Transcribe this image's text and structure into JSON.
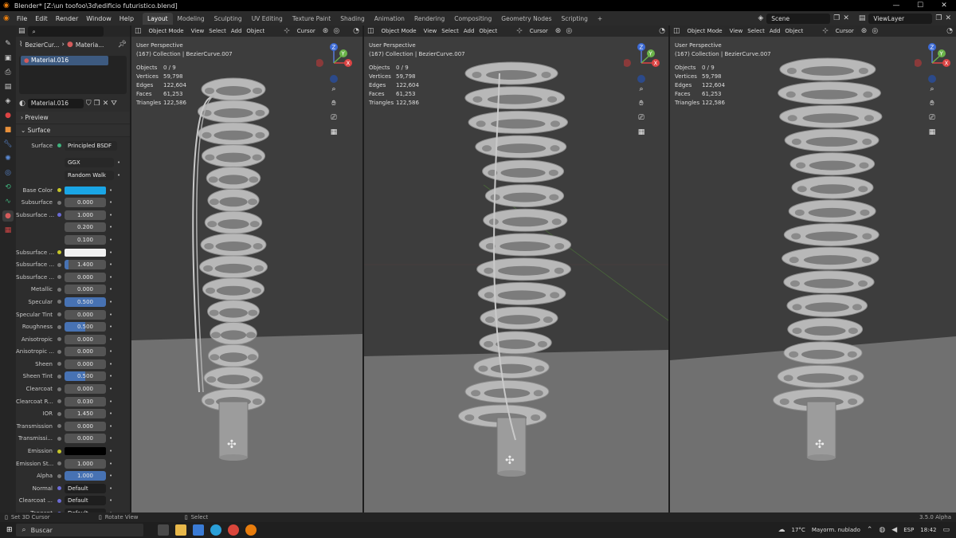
{
  "window": {
    "title": "Blender* [Z:\\un toofoo\\3d\\edificio futuristico.blend]",
    "controls": [
      "—",
      "☐",
      "✕"
    ]
  },
  "menu": {
    "items": [
      "File",
      "Edit",
      "Render",
      "Window",
      "Help"
    ]
  },
  "workspaces": [
    "Layout",
    "Modeling",
    "Sculpting",
    "UV Editing",
    "Texture Paint",
    "Shading",
    "Animation",
    "Rendering",
    "Compositing",
    "Geometry Nodes",
    "Scripting",
    "+"
  ],
  "scene": {
    "label": "Scene"
  },
  "viewlayer": {
    "label": "ViewLayer"
  },
  "properties": {
    "breadcrumb": [
      "BezierCur...",
      "Materia..."
    ],
    "slot": "Material.016",
    "material": "Material.016",
    "panels": {
      "preview": "Preview",
      "surface": "Surface"
    },
    "surface_shader": {
      "label": "Surface",
      "value": "Principled BSDF"
    },
    "distribution": "GGX",
    "subsurface_method": "Random Walk",
    "rows": [
      {
        "label": "Base Color",
        "type": "color",
        "color": "#1aa6e6"
      },
      {
        "label": "Subsurface",
        "type": "num",
        "value": "0.000"
      },
      {
        "label": "Subsurface ...",
        "type": "num",
        "value": "1.000",
        "dot": "blue"
      },
      {
        "label": "",
        "type": "num",
        "value": "0.200",
        "nodot": true
      },
      {
        "label": "",
        "type": "num",
        "value": "0.100",
        "nodot": true
      },
      {
        "label": "Subsurface ...",
        "type": "color",
        "color": "#f0f0f0"
      },
      {
        "label": "Subsurface ...",
        "type": "num",
        "value": "1.400",
        "fill": "part"
      },
      {
        "label": "Subsurface ...",
        "type": "num",
        "value": "0.000"
      },
      {
        "label": "Metallic",
        "type": "num",
        "value": "0.000"
      },
      {
        "label": "Specular",
        "type": "num",
        "value": "0.500",
        "fill": "full"
      },
      {
        "label": "Specular Tint",
        "type": "num",
        "value": "0.000"
      },
      {
        "label": "Roughness",
        "type": "num",
        "value": "0.500",
        "fill": "half"
      },
      {
        "label": "Anisotropic",
        "type": "num",
        "value": "0.000"
      },
      {
        "label": "Anisotropic ...",
        "type": "num",
        "value": "0.000"
      },
      {
        "label": "Sheen",
        "type": "num",
        "value": "0.000"
      },
      {
        "label": "Sheen Tint",
        "type": "num",
        "value": "0.500",
        "fill": "half"
      },
      {
        "label": "Clearcoat",
        "type": "num",
        "value": "0.000"
      },
      {
        "label": "Clearcoat R...",
        "type": "num",
        "value": "0.030"
      },
      {
        "label": "IOR",
        "type": "num",
        "value": "1.450"
      },
      {
        "label": "Transmission",
        "type": "num",
        "value": "0.000"
      },
      {
        "label": "Transmissi...",
        "type": "num",
        "value": "0.000"
      },
      {
        "label": "Emission",
        "type": "color",
        "color": "#000000"
      },
      {
        "label": "Emission St...",
        "type": "num",
        "value": "1.000"
      },
      {
        "label": "Alpha",
        "type": "num",
        "value": "1.000",
        "fill": "full"
      },
      {
        "label": "Normal",
        "type": "text",
        "value": "Default",
        "dot": "blue"
      },
      {
        "label": "Clearcoat ...",
        "type": "text",
        "value": "Default",
        "dot": "blue"
      },
      {
        "label": "Tangent",
        "type": "text",
        "value": "Default",
        "dot": "blue"
      }
    ]
  },
  "viewport": {
    "header": {
      "mode": "Object Mode",
      "menus": [
        "View",
        "Select",
        "Add",
        "Object"
      ],
      "pivot": "Cursor"
    },
    "perspective": "User Perspective",
    "collection": "(167) Collection | BezierCurve.007",
    "stats": [
      {
        "k": "Objects",
        "v": "0 / 9"
      },
      {
        "k": "Vertices",
        "v": "59,798"
      },
      {
        "k": "Edges",
        "v": "122,604"
      },
      {
        "k": "Faces",
        "v": "61,253"
      },
      {
        "k": "Triangles",
        "v": "122,586"
      }
    ],
    "gizmo": {
      "z": "Z",
      "y": "Y",
      "x": "X"
    }
  },
  "statusbar": {
    "left": "Set 3D Cursor",
    "mid": "Rotate View",
    "right_action": "Select",
    "version": "3.5.0 Alpha"
  },
  "taskbar": {
    "search": "Buscar",
    "weather_temp": "17°C",
    "weather_text": "Mayorm. nublado",
    "lang": "ESP",
    "time": "18:42"
  }
}
